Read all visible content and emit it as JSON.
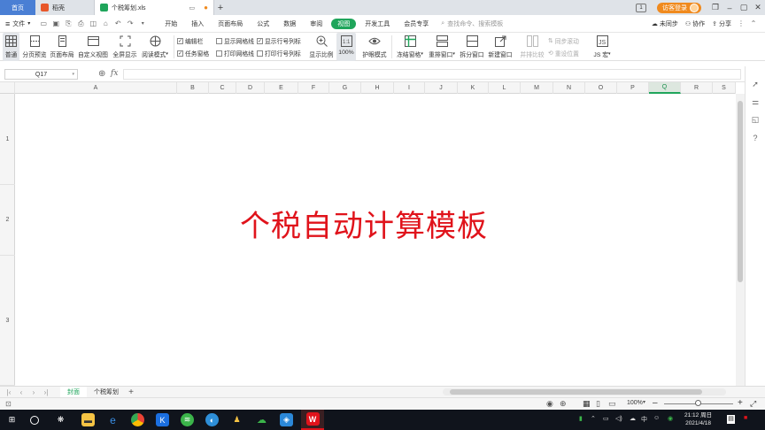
{
  "titlebar": {
    "tabs": [
      "首页",
      "稻壳",
      "个税筹划.xls"
    ],
    "login_label": "访客登录",
    "badge": "1"
  },
  "menubar": {
    "file_label": "文件",
    "menus": [
      "开始",
      "插入",
      "页面布局",
      "公式",
      "数据",
      "审阅",
      "视图",
      "开发工具",
      "会员专享"
    ],
    "active_menu": "视图",
    "search_placeholder": "查找命令、搜索模板",
    "unsync_label": "未同步",
    "collab_label": "协作",
    "share_label": "分享"
  },
  "ribbon": {
    "normal": "普通",
    "page_break_preview": "分页预览",
    "page_layout": "页面布局",
    "custom_view": "自定义视图",
    "fullscreen": "全屏显示",
    "reading_mode": "阅读模式",
    "edit_bar": "编辑栏",
    "task_pane": "任务窗格",
    "show_gridlines": "显示网格线",
    "print_gridlines": "打印网格线",
    "show_headers": "显示行号列标",
    "print_headers": "打印行号列标",
    "zoom_ratio": "显示比例",
    "zoom_100": "100%",
    "eye_mode": "护眼模式",
    "freeze_panes": "冻结窗格",
    "arrange_windows": "重排窗口",
    "split_window": "拆分窗口",
    "new_window": "新建窗口",
    "side_by_side": "并排比较",
    "sync_scroll": "同步滚动",
    "reset_position": "重设位置",
    "js_macro": "JS 宏"
  },
  "formulabar": {
    "cell_ref": "Q17",
    "fx_label": "fx",
    "formula": ""
  },
  "grid": {
    "columns": [
      "A",
      "B",
      "C",
      "D",
      "E",
      "F",
      "G",
      "H",
      "I",
      "J",
      "K",
      "L",
      "M",
      "N",
      "O",
      "P",
      "Q",
      "R",
      "S"
    ],
    "selected_column": "Q",
    "rows": [
      "1",
      "2",
      "3"
    ],
    "title_text": "个税自动计算模板"
  },
  "sheets": {
    "tabs": [
      "封面",
      "个税筹划"
    ],
    "active": "封面",
    "add_label": "+"
  },
  "statusbar": {
    "zoom": "100%"
  },
  "taskbar": {
    "time": "21:12 周日",
    "date": "2021/4/18",
    "ime": "中"
  },
  "colors": {
    "accent_green": "#1fa55b",
    "title_red": "#e0131b",
    "home_tab_blue": "#4a7fd4"
  }
}
